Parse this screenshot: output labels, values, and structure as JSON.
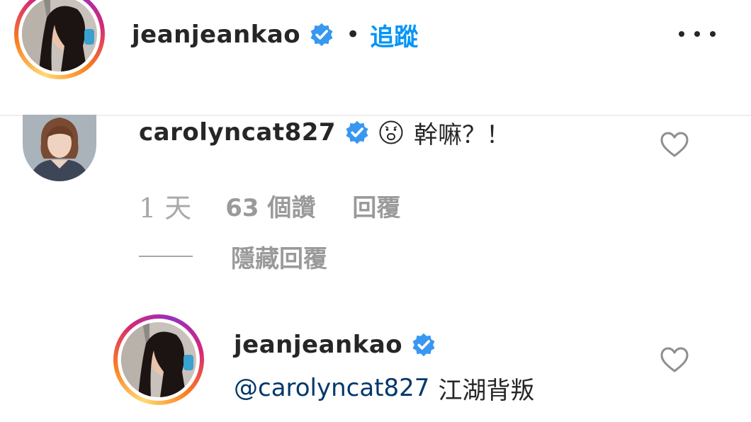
{
  "header": {
    "username": "jeanjeankao",
    "separator": "•",
    "follow_label": "追蹤",
    "verified_icon": "verified-badge-icon",
    "more_icon": "more-options-icon"
  },
  "comment": {
    "username": "carolyncat827",
    "emoji_icon": "anguished-face-icon",
    "text": "幹嘛？！",
    "time": "1 天",
    "likes": "63 個讚",
    "reply_label": "回覆",
    "hide_replies_label": "隱藏回覆"
  },
  "reply": {
    "username": "jeanjeankao",
    "mention": "@carolyncat827",
    "text": "江湖背叛"
  },
  "colors": {
    "verified": "#3897f0",
    "link": "#0095f6",
    "mention": "#00376b",
    "muted": "#a8a8a8"
  }
}
